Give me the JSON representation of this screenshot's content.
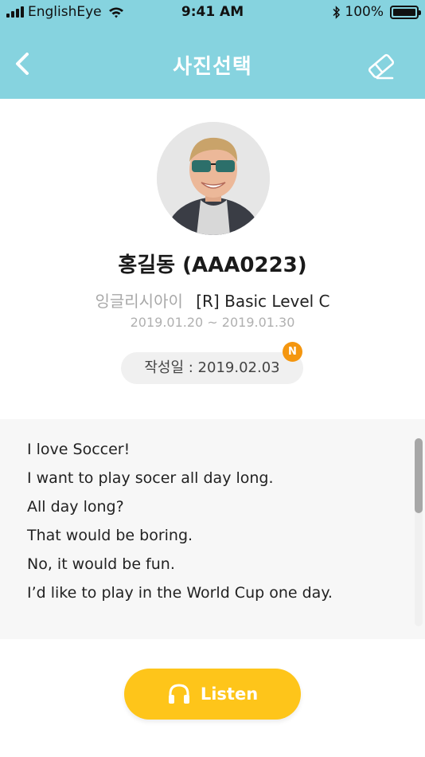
{
  "status_bar": {
    "carrier": "EnglishEye",
    "time": "9:41 AM",
    "battery": "100%"
  },
  "header": {
    "title": "사진선택",
    "background_color": "#86d3df"
  },
  "profile": {
    "name": "홍길동 (AAA0223)",
    "school": "잉글리시아이",
    "course": "[R] Basic Level C",
    "period": "2019.01.20 ~ 2019.01.30",
    "written_date": "작성일 : 2019.02.03",
    "new_badge": "N",
    "badge_color": "#f4960f"
  },
  "content": {
    "lines": [
      "I love Soccer!",
      "I want to play socer all day long.",
      "All day long?",
      "That would be boring.",
      "No, it would be fun.",
      "I’d like to play in the World Cup one day."
    ]
  },
  "listen_button": {
    "label": "Listen",
    "color": "#fec51a"
  },
  "icons": {
    "back": "chevron-left-icon",
    "eraser": "eraser-icon",
    "listen": "headphones-icon",
    "wifi": "wifi-icon",
    "bluetooth": "bluetooth-icon"
  }
}
